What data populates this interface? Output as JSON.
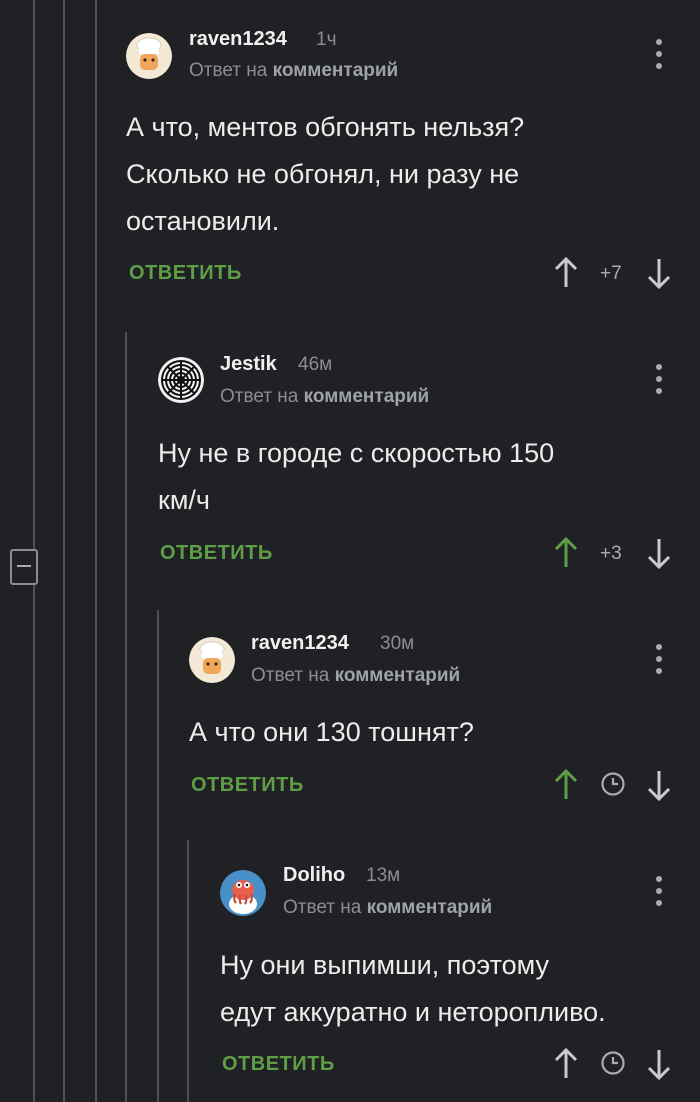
{
  "labels": {
    "reply_to_prefix": "Ответ на",
    "reply_to_target": "комментарий",
    "reply_button": "ОТВЕТИТЬ"
  },
  "colors": {
    "background": "#202124",
    "accent_green": "#5f9e46",
    "text_muted": "#8a8d91"
  },
  "comments": [
    {
      "author": "raven1234",
      "time": "1ч",
      "avatar": "chef-cat-avatar",
      "lines": [
        "А что, ментов обгонять нельзя?",
        "Сколько не обгонял, ни разу не",
        "остановили."
      ],
      "score": "+7",
      "upvoted": false
    },
    {
      "author": "Jestik",
      "time": "46м",
      "avatar": "spiral-pattern-avatar",
      "lines": [
        "Ну не в городе с скоростью 150",
        "км/ч"
      ],
      "score": "+3",
      "upvoted": true
    },
    {
      "author": "raven1234",
      "time": "30м",
      "avatar": "chef-cat-avatar",
      "lines": [
        "А что они 130 тошнят?"
      ],
      "score": "",
      "upvoted": true
    },
    {
      "author": "Doliho",
      "time": "13м",
      "avatar": "zoidberg-avatar",
      "lines": [
        "Ну они выпимши, поэтому",
        "едут аккуратно и неторопливо."
      ],
      "score": "",
      "upvoted": false
    }
  ]
}
